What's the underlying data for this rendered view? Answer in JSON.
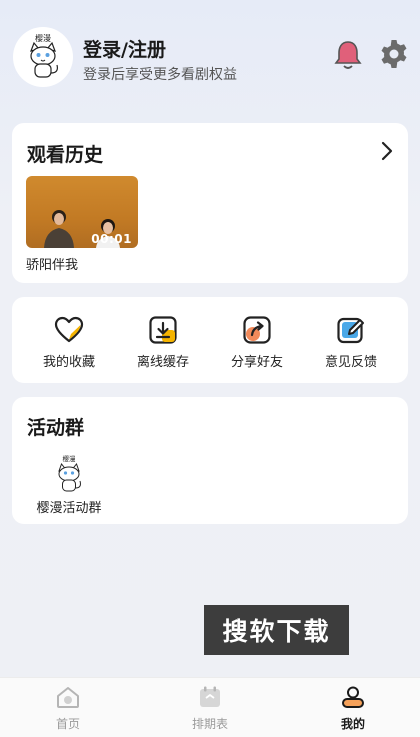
{
  "header": {
    "title": "登录/注册",
    "subtitle": "登录后享受更多看剧权益",
    "avatar_text": "樱漫"
  },
  "history": {
    "title": "观看历史",
    "items": [
      {
        "label": "骄阳伴我",
        "time": "00:01"
      }
    ]
  },
  "actions": [
    {
      "label": "我的收藏",
      "icon": "heart-icon"
    },
    {
      "label": "离线缓存",
      "icon": "download-icon"
    },
    {
      "label": "分享好友",
      "icon": "share-icon"
    },
    {
      "label": "意见反馈",
      "icon": "feedback-icon"
    }
  ],
  "groups": {
    "title": "活动群",
    "items": [
      {
        "label": "樱漫活动群",
        "badge_text": "樱漫"
      }
    ]
  },
  "watermark": "搜软下载",
  "tabs": [
    {
      "label": "首页",
      "icon": "home-icon",
      "active": false
    },
    {
      "label": "排期表",
      "icon": "calendar-icon",
      "active": false
    },
    {
      "label": "我的",
      "icon": "profile-icon",
      "active": true
    }
  ],
  "colors": {
    "accent": "#f5b400",
    "bell": "#e0607a",
    "active_tab": "#1a1a1a",
    "inactive_tab": "#9a9a9a"
  }
}
